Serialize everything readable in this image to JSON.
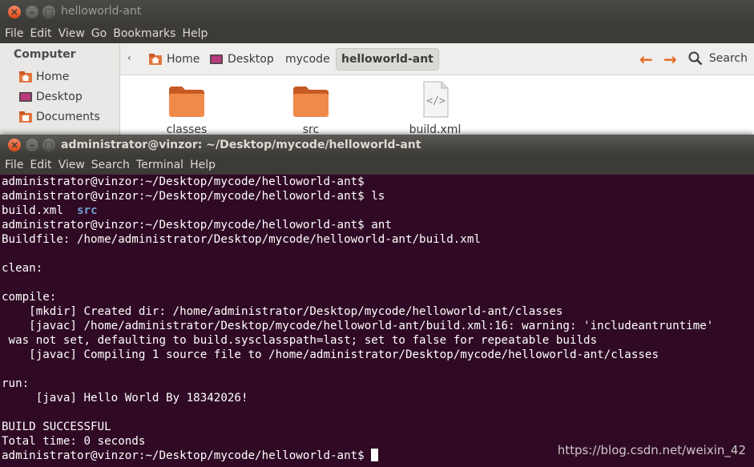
{
  "file_manager": {
    "title": "helloworld-ant",
    "menu": [
      "File",
      "Edit",
      "View",
      "Go",
      "Bookmarks",
      "Help"
    ],
    "sidebar": {
      "heading": "Computer",
      "items": [
        {
          "label": "Home",
          "icon": "home-folder-icon"
        },
        {
          "label": "Desktop",
          "icon": "desktop-icon"
        },
        {
          "label": "Documents",
          "icon": "documents-folder-icon"
        }
      ]
    },
    "breadcrumbs": [
      {
        "label": "Home",
        "icon": "home-folder-icon"
      },
      {
        "label": "Desktop",
        "icon": "desktop-icon"
      },
      {
        "label": "mycode"
      },
      {
        "label": "helloworld-ant",
        "active": true
      }
    ],
    "search_label": "Search",
    "files": [
      {
        "name": "classes",
        "type": "folder"
      },
      {
        "name": "src",
        "type": "folder"
      },
      {
        "name": "build.xml",
        "type": "xml-file"
      }
    ]
  },
  "terminal": {
    "title": "administrator@vinzor: ~/Desktop/mycode/helloworld-ant",
    "menu": [
      "File",
      "Edit",
      "View",
      "Search",
      "Terminal",
      "Help"
    ],
    "lines": [
      "administrator@vinzor:~/Desktop/mycode/helloworld-ant$",
      "administrator@vinzor:~/Desktop/mycode/helloworld-ant$ ls",
      "build.xml  ",
      "administrator@vinzor:~/Desktop/mycode/helloworld-ant$ ant",
      "Buildfile: /home/administrator/Desktop/mycode/helloworld-ant/build.xml",
      "",
      "clean:",
      "",
      "compile:",
      "    [mkdir] Created dir: /home/administrator/Desktop/mycode/helloworld-ant/classes",
      "    [javac] /home/administrator/Desktop/mycode/helloworld-ant/build.xml:16: warning: 'includeantruntime'",
      " was not set, defaulting to build.sysclasspath=last; set to false for repeatable builds",
      "    [javac] Compiling 1 source file to /home/administrator/Desktop/mycode/helloworld-ant/classes",
      "",
      "run:",
      "     [java] Hello World By 18342026!",
      "",
      "BUILD SUCCESSFUL",
      "Total time: 0 seconds",
      "administrator@vinzor:~/Desktop/mycode/helloworld-ant$ "
    ],
    "ls_dir_entry": "src"
  },
  "watermark": "https://blog.csdn.net/weixin_42",
  "colors": {
    "terminal_bg": "#300a24",
    "ubuntu_orange": "#e46a22",
    "dir_blue": "#729fcf"
  }
}
